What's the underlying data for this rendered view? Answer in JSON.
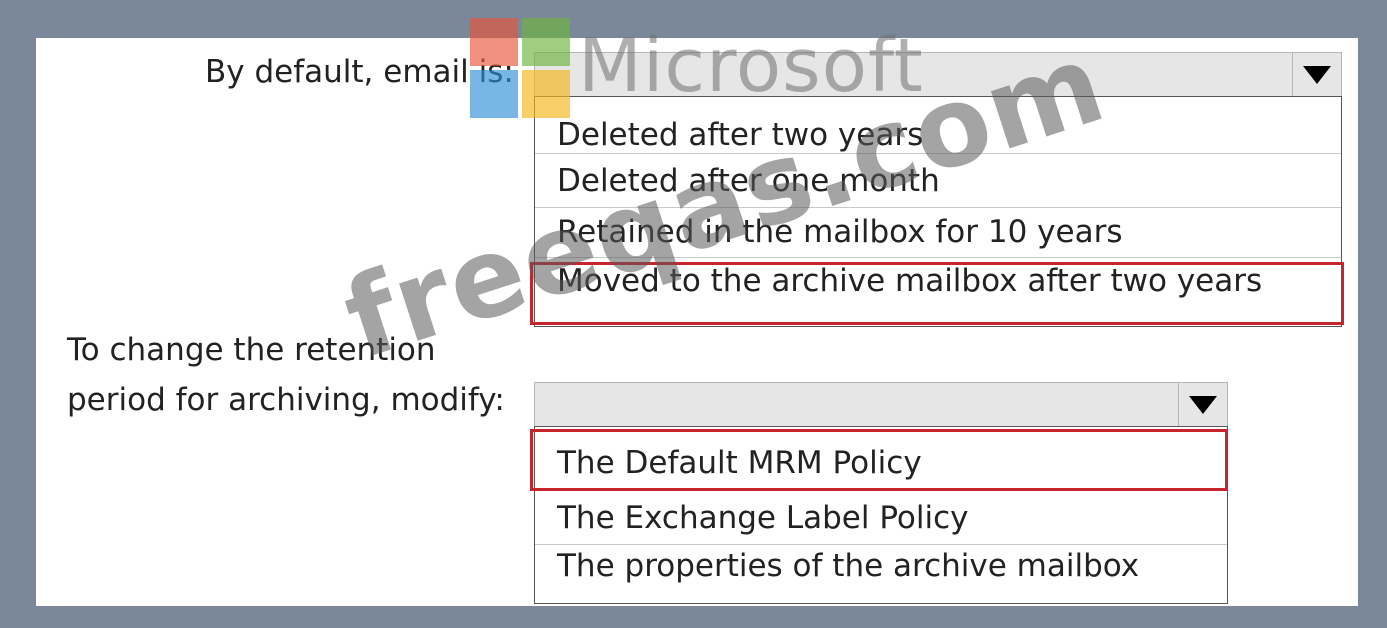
{
  "question1": {
    "label": "By default, email is:",
    "selected": "Moved to the archive mailbox after two years",
    "options": [
      "Deleted after two years",
      "Deleted after one month",
      "Retained in the mailbox for 10 years",
      "Moved to the archive mailbox after two years"
    ]
  },
  "question2": {
    "label_line1": "To change the retention",
    "label_line2": "period for archiving, modify:",
    "selected": "The Default MRM Policy",
    "options": [
      "The Default MRM Policy",
      "The Exchange Label Policy",
      "The properties of the archive mailbox"
    ]
  },
  "watermarks": {
    "logo_text": "Microsoft",
    "logo_colors": [
      "#e8553a",
      "#6cb33e",
      "#2f8fd8",
      "#f6b51a"
    ],
    "site_text": "freeqas.com"
  },
  "icons": {
    "dropdown": "dropdown-arrow-icon"
  },
  "colors": {
    "selection_outline": "#c8242e"
  }
}
